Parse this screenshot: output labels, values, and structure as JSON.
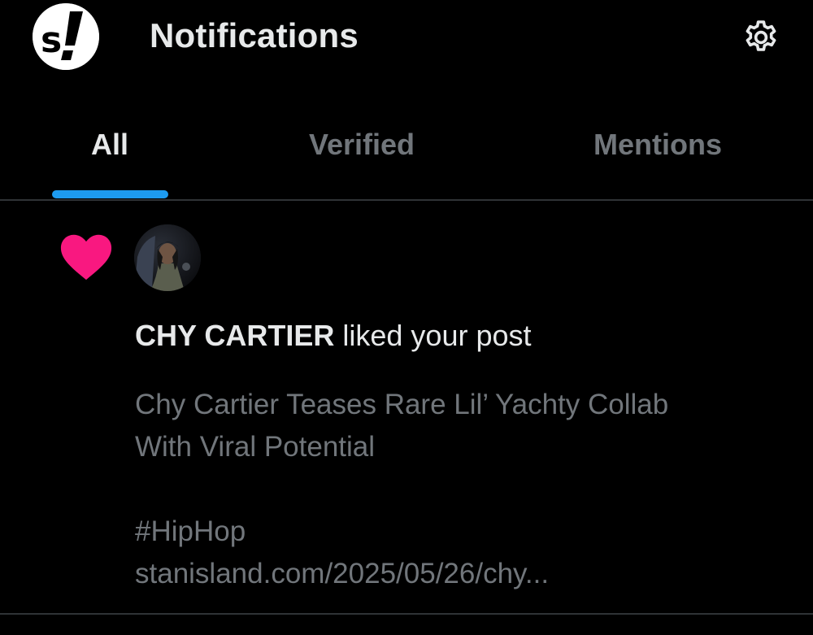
{
  "header": {
    "logo_icon": "stanisland-logo-icon",
    "title": "Notifications",
    "settings_icon": "gear-icon"
  },
  "tabs": [
    {
      "label": "All",
      "active": true
    },
    {
      "label": "Verified",
      "active": false
    },
    {
      "label": "Mentions",
      "active": false
    }
  ],
  "notification": {
    "type_icon": "heart-icon",
    "type_color": "#f91880",
    "user": "CHY CARTIER",
    "action": "liked your post",
    "post": {
      "line1": "Chy Cartier Teases Rare Lil’ Yachty Collab",
      "line2": "With Viral Potential",
      "hashtag": "#HipHop",
      "link": "stanisland.com/2025/05/26/chy..."
    }
  },
  "colors": {
    "background": "#000000",
    "primary_text": "#e7e9ea",
    "secondary_text": "#71767b",
    "accent": "#1d9bf0",
    "divider": "#2f3336"
  }
}
